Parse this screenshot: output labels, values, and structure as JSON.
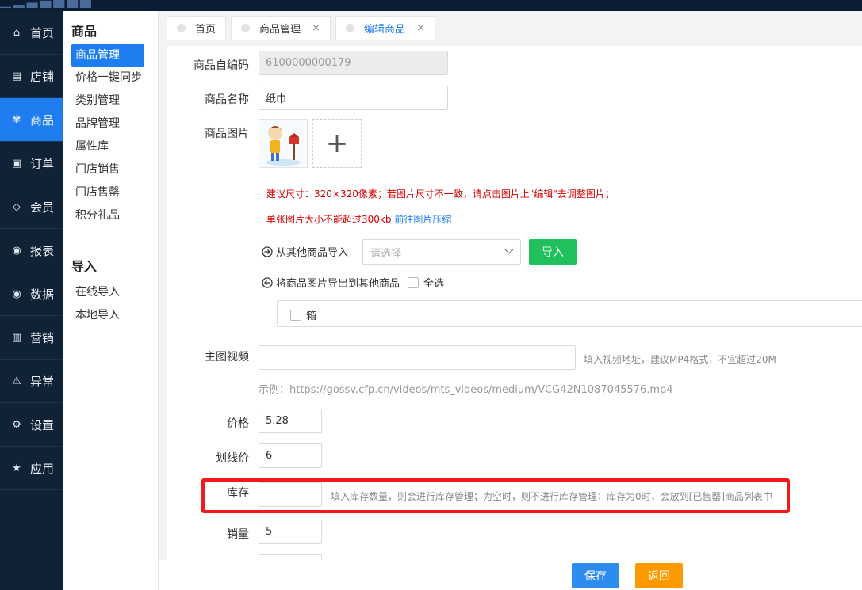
{
  "primary_nav": [
    {
      "label": "首页",
      "icon": "home-icon",
      "glyph": "⌂"
    },
    {
      "label": "店铺",
      "icon": "store-icon",
      "glyph": "▤"
    },
    {
      "label": "商品",
      "icon": "gift-icon",
      "glyph": "✾"
    },
    {
      "label": "订单",
      "icon": "order-icon",
      "glyph": "▣"
    },
    {
      "label": "会员",
      "icon": "member-icon",
      "glyph": "◇"
    },
    {
      "label": "报表",
      "icon": "report-icon",
      "glyph": "◉"
    },
    {
      "label": "数据",
      "icon": "data-icon",
      "glyph": "◉"
    },
    {
      "label": "营销",
      "icon": "marketing-icon",
      "glyph": "▥"
    },
    {
      "label": "异常",
      "icon": "warning-icon",
      "glyph": "⚠"
    },
    {
      "label": "设置",
      "icon": "settings-icon",
      "glyph": "⚙"
    },
    {
      "label": "应用",
      "icon": "star-icon",
      "glyph": "★"
    }
  ],
  "secondary_nav": {
    "group1_title": "商品",
    "group1_items": [
      "商品管理",
      "价格一键同步",
      "类别管理",
      "品牌管理",
      "属性库",
      "门店销售",
      "门店售罄",
      "积分礼品"
    ],
    "group2_title": "导入",
    "group2_items": [
      "在线导入",
      "本地导入"
    ]
  },
  "tabs": [
    {
      "label": "首页"
    },
    {
      "label": "商品管理",
      "close": "×"
    },
    {
      "label": "编辑商品",
      "close": "×"
    }
  ],
  "form": {
    "code_label": "商品自编码",
    "code_value": "6100000000179",
    "name_label": "商品名称",
    "name_value": "纸巾",
    "image_label": "商品图片",
    "add_glyph": "+",
    "size_tip": "建议尺寸：320×320像素；若图片尺寸不一致，请点击图片上\"编辑\"去调整图片；",
    "size_limit": "单张图片大小不能超过300kb",
    "compress_link": "前往图片压缩",
    "import_from_label": "从其他商品导入",
    "import_select_placeholder": "请选择",
    "import_button": "导入",
    "export_label": "将商品图片导出到其他商品",
    "select_all": "全选",
    "box_option": "箱",
    "video_label": "主图视频",
    "video_hint": "填入视频地址，建议MP4格式，不宜超过20M",
    "video_example": "示例：https://gossv.cfp.cn/videos/mts_videos/medium/VCG42N1087045576.mp4",
    "price_label": "价格",
    "price_value": "5.28",
    "strike_label": "划线价",
    "strike_value": "6",
    "stock_label": "库存",
    "stock_value": "",
    "stock_hint": "填入库存数量，则会进行库存管理；为空时，则不进行库存管理；库存为0时，会放到[已售罄]商品列表中",
    "sales_label": "销量",
    "sales_value": "5"
  },
  "footer": {
    "save": "保存",
    "back": "返回"
  },
  "colors": {
    "accent": "#1e7ef0",
    "sidebar_bg": "#0f2236",
    "import_btn": "#20c05c",
    "save_btn": "#2d8cf0",
    "back_btn": "#ff9900",
    "highlight": "#ee1c1c",
    "tip_red": "#d60000"
  }
}
